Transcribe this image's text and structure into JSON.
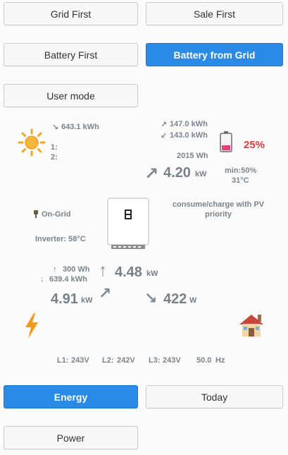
{
  "mode_buttons": {
    "grid_first": "Grid First",
    "sale_first": "Sale First",
    "battery_first": "Battery First",
    "battery_from_grid": "Battery from Grid",
    "user_mode": "User mode"
  },
  "solar": {
    "total_energy": "643.1 kWh",
    "string1_label": "1:",
    "string2_label": "2:"
  },
  "battery": {
    "charge_energy": "147.0 kWh",
    "discharge_energy": "143.0 kWh",
    "capacity": "2015 Wh",
    "soc_percent": "25%",
    "power_value": "4.20",
    "power_unit": "kW",
    "min_soc": "min:50%",
    "temperature": "31°C",
    "mode_text": "consume/charge with PV priority"
  },
  "inverter": {
    "grid_status": "On-Grid",
    "temperature": "Inverter: 58°C"
  },
  "grid": {
    "import_energy": "300 Wh",
    "export_energy": "639.4 kWh",
    "power_value": "4.91",
    "power_unit": "kW",
    "phases": {
      "l1_label": "L1:",
      "l1_value": "243V",
      "l2_label": "L2:",
      "l2_value": "242V",
      "l3_label": "L3:",
      "l3_value": "243V",
      "frequency_value": "50.0",
      "frequency_unit": "Hz"
    }
  },
  "flow": {
    "inverter_to_grid_value": "4.48",
    "inverter_to_grid_unit": "kW",
    "home_power_value": "422",
    "home_power_unit": "W"
  },
  "view_buttons": {
    "energy": "Energy",
    "today": "Today",
    "power": "Power"
  },
  "colors": {
    "accent": "#2a8be6",
    "soc_red": "#e23a3a",
    "text_gray": "#7b848d"
  }
}
